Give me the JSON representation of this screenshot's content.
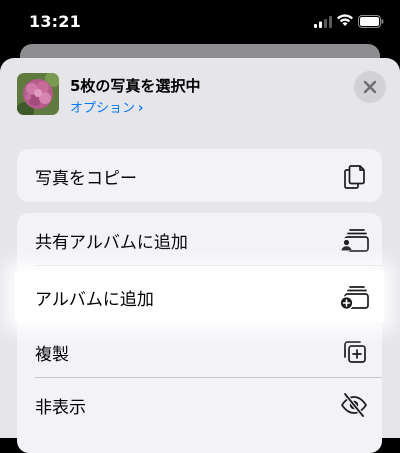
{
  "status_bar": {
    "time": "13:21"
  },
  "header": {
    "title": "5枚の写真を選択中",
    "options_label": "オプション",
    "options_chevron": "›"
  },
  "actions": {
    "copy_photos": "写真をコピー",
    "add_to_shared_album": "共有アルバムに追加",
    "add_to_album": "アルバムに追加",
    "duplicate": "複製",
    "hide": "非表示"
  },
  "colors": {
    "accent": "#007aff",
    "sheet_background": "#e5e5ea",
    "row_background": "#f2f2f7",
    "highlight": "#ffffff"
  }
}
